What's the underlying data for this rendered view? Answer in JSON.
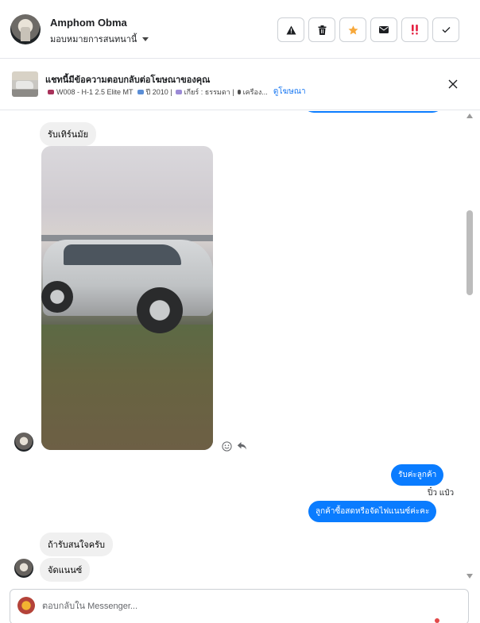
{
  "header": {
    "contact_name": "Amphom Obma",
    "assign_label": "มอบหมายการสนทนานี้",
    "actions": [
      {
        "name": "report-spam-button",
        "icon": "warning-icon"
      },
      {
        "name": "delete-button",
        "icon": "trash-icon"
      },
      {
        "name": "star-button",
        "icon": "star-icon"
      },
      {
        "name": "mark-unread-button",
        "icon": "envelope-icon"
      },
      {
        "name": "follow-up-button",
        "icon": "double-exclamation-icon"
      },
      {
        "name": "mark-done-button",
        "icon": "checkmark-icon"
      }
    ]
  },
  "ad_banner": {
    "title": "แชทนี้มีข้อความตอบกลับต่อโฆษณาของคุณ",
    "details": [
      "W008 - H-1 2.5 Elite MT",
      "ปี 2010 |",
      "เกียร์ : ธรรมดา |",
      "เครือง..."
    ],
    "view_ad_link": "ดูโฆษณา"
  },
  "messages": {
    "incoming_question": "รับเทิร์นมัย",
    "reply_1": "รับค่ะลูกค้า",
    "sender_name": "ปิ๋ว แป๋ว",
    "reply_2": "ลูกค้าซื้อสดหรือจัดไฟแนนซ์ค่ะคะ",
    "incoming_1": "ถ้ารับสนใจครับ",
    "incoming_2": "จัดแนนซ์"
  },
  "composer": {
    "placeholder": "ตอบกลับใน Messenger..."
  },
  "colors": {
    "accent": "#0a7cff",
    "star": "#f7a83b",
    "flag": "#e41e3f"
  }
}
